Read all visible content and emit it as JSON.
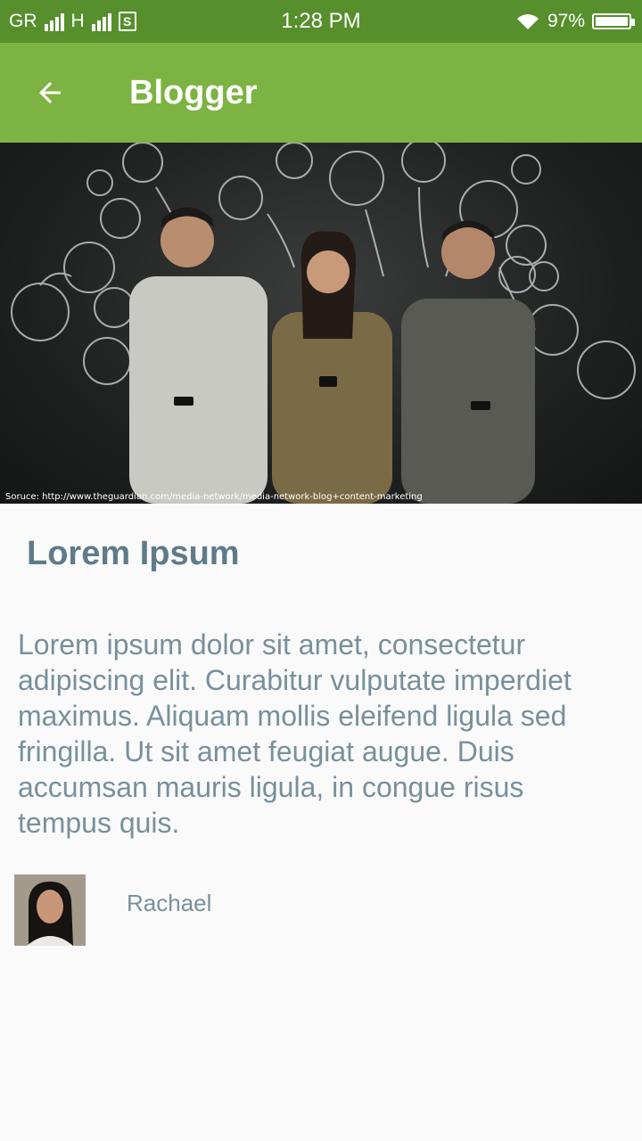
{
  "status_bar": {
    "network_label": "GR",
    "network2_label": "H",
    "sim_label": "S",
    "time": "1:28 PM",
    "battery": "97%",
    "battery_level": 0.97
  },
  "app_bar": {
    "back_icon": "arrow-back-icon",
    "title": "Blogger"
  },
  "hero": {
    "caption": "Soruce: http://www.theguardian.com/media-network/media-network-blog+content-marketing"
  },
  "post": {
    "title": "Lorem Ipsum",
    "body": "Lorem ipsum dolor sit amet, consectetur adipiscing elit. Curabitur vulputate imperdiet maximus. Aliquam mollis eleifend ligula sed fringilla. Ut sit amet feugiat augue. Duis accumsan mauris ligula, in congue risus tempus quis."
  },
  "author": {
    "name": "Rachael"
  },
  "colors": {
    "status_bar": "#568f2c",
    "app_bar": "#7cb342",
    "title_text": "#5f7b8a",
    "body_text": "#78909c"
  }
}
